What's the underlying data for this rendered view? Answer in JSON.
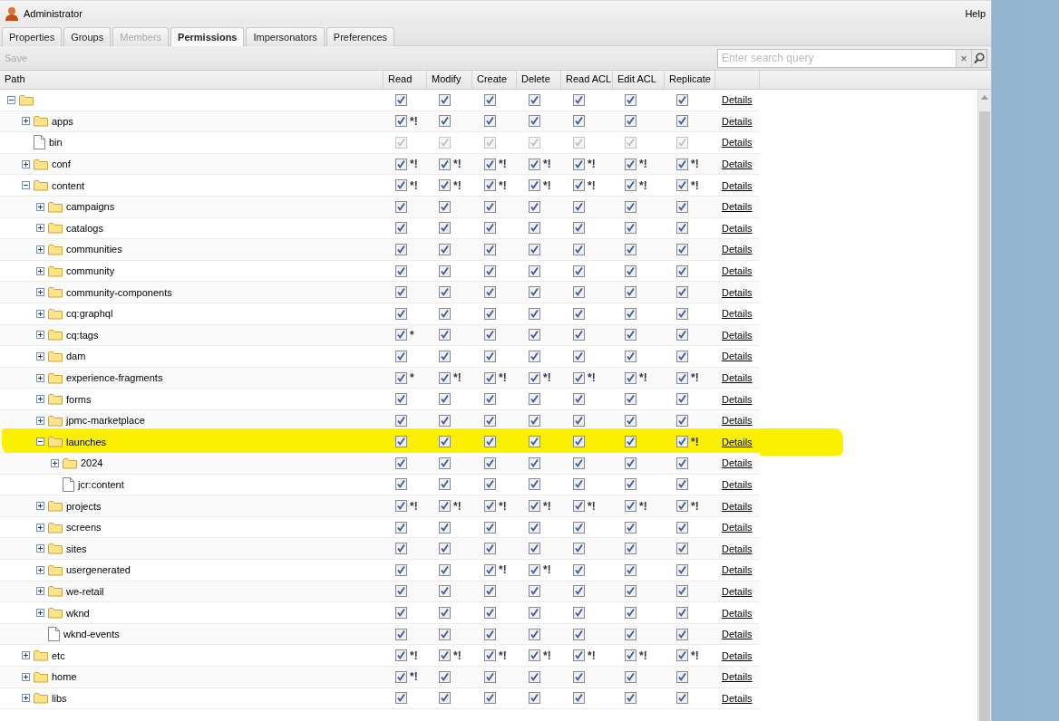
{
  "window": {
    "title": "Administrator",
    "help": "Help"
  },
  "tabs": [
    {
      "label": "Properties",
      "selected": false,
      "disabled": false
    },
    {
      "label": "Groups",
      "selected": false,
      "disabled": false
    },
    {
      "label": "Members",
      "selected": false,
      "disabled": true
    },
    {
      "label": "Permissions",
      "selected": true,
      "disabled": false
    },
    {
      "label": "Impersonators",
      "selected": false,
      "disabled": false
    },
    {
      "label": "Preferences",
      "selected": false,
      "disabled": false
    }
  ],
  "toolbar": {
    "save": {
      "label": "Save",
      "disabled": true
    },
    "search": {
      "placeholder": "Enter search query",
      "clear": "×"
    }
  },
  "table": {
    "columns": [
      "Path",
      "Read",
      "Modify",
      "Create",
      "Delete",
      "Read ACL",
      "Edit ACL",
      "Replicate"
    ],
    "tree": [
      {
        "kind": "folder",
        "expanded": true,
        "disabled": false,
        "highlighted": false,
        "details": "Details",
        "perms": [
          {
            "checked": true
          },
          {
            "checked": true
          },
          {
            "checked": true
          },
          {
            "checked": true
          },
          {
            "checked": true
          },
          {
            "checked": true
          },
          {
            "checked": true
          }
        ],
        "children": [
          {
            "name": "apps",
            "kind": "folder",
            "expanded": false,
            "disabled": false,
            "highlighted": false,
            "details": "Details",
            "perms": [
              {
                "checked": true,
                "note": "*!"
              },
              {
                "checked": true
              },
              {
                "checked": true
              },
              {
                "checked": true
              },
              {
                "checked": true
              },
              {
                "checked": true
              },
              {
                "checked": true
              }
            ]
          },
          {
            "name": "bin",
            "kind": "file",
            "disabled": true,
            "highlighted": false,
            "details": "Details",
            "perms": [
              {
                "checked": true
              },
              {
                "checked": true
              },
              {
                "checked": true
              },
              {
                "checked": true
              },
              {
                "checked": true
              },
              {
                "checked": true
              },
              {
                "checked": true
              }
            ]
          },
          {
            "name": "conf",
            "kind": "folder",
            "expanded": false,
            "disabled": false,
            "highlighted": false,
            "details": "Details",
            "perms": [
              {
                "checked": true,
                "note": "*!"
              },
              {
                "checked": true,
                "note": "*!"
              },
              {
                "checked": true,
                "note": "*!"
              },
              {
                "checked": true,
                "note": "*!"
              },
              {
                "checked": true,
                "note": "*!"
              },
              {
                "checked": true,
                "note": "*!"
              },
              {
                "checked": true,
                "note": "*!"
              }
            ]
          },
          {
            "name": "content",
            "kind": "folder",
            "expanded": true,
            "disabled": false,
            "highlighted": false,
            "details": "Details",
            "perms": [
              {
                "checked": true,
                "note": "*!"
              },
              {
                "checked": true,
                "note": "*!"
              },
              {
                "checked": true,
                "note": "*!"
              },
              {
                "checked": true,
                "note": "*!"
              },
              {
                "checked": true,
                "note": "*!"
              },
              {
                "checked": true,
                "note": "*!"
              },
              {
                "checked": true,
                "note": "*!"
              }
            ],
            "children": [
              {
                "name": "campaigns",
                "kind": "folder",
                "expanded": false,
                "disabled": false,
                "highlighted": false,
                "details": "Details",
                "perms": [
                  {
                    "checked": true
                  },
                  {
                    "checked": true
                  },
                  {
                    "checked": true
                  },
                  {
                    "checked": true
                  },
                  {
                    "checked": true
                  },
                  {
                    "checked": true
                  },
                  {
                    "checked": true
                  }
                ]
              },
              {
                "name": "catalogs",
                "kind": "folder",
                "expanded": false,
                "disabled": false,
                "highlighted": false,
                "details": "Details",
                "perms": [
                  {
                    "checked": true
                  },
                  {
                    "checked": true
                  },
                  {
                    "checked": true
                  },
                  {
                    "checked": true
                  },
                  {
                    "checked": true
                  },
                  {
                    "checked": true
                  },
                  {
                    "checked": true
                  }
                ]
              },
              {
                "name": "communities",
                "kind": "folder",
                "expanded": false,
                "disabled": false,
                "highlighted": false,
                "details": "Details",
                "perms": [
                  {
                    "checked": true
                  },
                  {
                    "checked": true
                  },
                  {
                    "checked": true
                  },
                  {
                    "checked": true
                  },
                  {
                    "checked": true
                  },
                  {
                    "checked": true
                  },
                  {
                    "checked": true
                  }
                ]
              },
              {
                "name": "community",
                "kind": "folder",
                "expanded": false,
                "disabled": false,
                "highlighted": false,
                "details": "Details",
                "perms": [
                  {
                    "checked": true
                  },
                  {
                    "checked": true
                  },
                  {
                    "checked": true
                  },
                  {
                    "checked": true
                  },
                  {
                    "checked": true
                  },
                  {
                    "checked": true
                  },
                  {
                    "checked": true
                  }
                ]
              },
              {
                "name": "community-components",
                "kind": "folder",
                "expanded": false,
                "disabled": false,
                "highlighted": false,
                "details": "Details",
                "perms": [
                  {
                    "checked": true
                  },
                  {
                    "checked": true
                  },
                  {
                    "checked": true
                  },
                  {
                    "checked": true
                  },
                  {
                    "checked": true
                  },
                  {
                    "checked": true
                  },
                  {
                    "checked": true
                  }
                ]
              },
              {
                "name": "cq:graphql",
                "kind": "folder",
                "expanded": false,
                "disabled": false,
                "highlighted": false,
                "details": "Details",
                "perms": [
                  {
                    "checked": true
                  },
                  {
                    "checked": true
                  },
                  {
                    "checked": true
                  },
                  {
                    "checked": true
                  },
                  {
                    "checked": true
                  },
                  {
                    "checked": true
                  },
                  {
                    "checked": true
                  }
                ]
              },
              {
                "name": "cq:tags",
                "kind": "folder",
                "expanded": false,
                "disabled": false,
                "highlighted": false,
                "details": "Details",
                "perms": [
                  {
                    "checked": true,
                    "note": "*"
                  },
                  {
                    "checked": true
                  },
                  {
                    "checked": true
                  },
                  {
                    "checked": true
                  },
                  {
                    "checked": true
                  },
                  {
                    "checked": true
                  },
                  {
                    "checked": true
                  }
                ]
              },
              {
                "name": "dam",
                "kind": "folder",
                "expanded": false,
                "disabled": false,
                "highlighted": false,
                "details": "Details",
                "perms": [
                  {
                    "checked": true
                  },
                  {
                    "checked": true
                  },
                  {
                    "checked": true
                  },
                  {
                    "checked": true
                  },
                  {
                    "checked": true
                  },
                  {
                    "checked": true
                  },
                  {
                    "checked": true
                  }
                ]
              },
              {
                "name": "experience-fragments",
                "kind": "folder",
                "expanded": false,
                "disabled": false,
                "highlighted": false,
                "details": "Details",
                "perms": [
                  {
                    "checked": true,
                    "note": "*"
                  },
                  {
                    "checked": true,
                    "note": "*!"
                  },
                  {
                    "checked": true,
                    "note": "*!"
                  },
                  {
                    "checked": true,
                    "note": "*!"
                  },
                  {
                    "checked": true,
                    "note": "*!"
                  },
                  {
                    "checked": true,
                    "note": "*!"
                  },
                  {
                    "checked": true,
                    "note": "*!"
                  }
                ]
              },
              {
                "name": "forms",
                "kind": "folder",
                "expanded": false,
                "disabled": false,
                "highlighted": false,
                "details": "Details",
                "perms": [
                  {
                    "checked": true
                  },
                  {
                    "checked": true
                  },
                  {
                    "checked": true
                  },
                  {
                    "checked": true
                  },
                  {
                    "checked": true
                  },
                  {
                    "checked": true
                  },
                  {
                    "checked": true
                  }
                ]
              },
              {
                "name": "jpmc-marketplace",
                "kind": "folder",
                "expanded": false,
                "disabled": false,
                "highlighted": false,
                "details": "Details",
                "perms": [
                  {
                    "checked": true
                  },
                  {
                    "checked": true
                  },
                  {
                    "checked": true
                  },
                  {
                    "checked": true
                  },
                  {
                    "checked": true
                  },
                  {
                    "checked": true
                  },
                  {
                    "checked": true
                  }
                ]
              },
              {
                "name": "launches",
                "kind": "folder",
                "expanded": true,
                "disabled": false,
                "highlighted": true,
                "details": "Details",
                "perms": [
                  {
                    "checked": true
                  },
                  {
                    "checked": true
                  },
                  {
                    "checked": true
                  },
                  {
                    "checked": true
                  },
                  {
                    "checked": true
                  },
                  {
                    "checked": true
                  },
                  {
                    "checked": true,
                    "note": "*!"
                  }
                ],
                "children": [
                  {
                    "name": "2024",
                    "kind": "folder",
                    "expanded": false,
                    "disabled": false,
                    "highlighted": false,
                    "details": "Details",
                    "perms": [
                      {
                        "checked": true
                      },
                      {
                        "checked": true
                      },
                      {
                        "checked": true
                      },
                      {
                        "checked": true
                      },
                      {
                        "checked": true
                      },
                      {
                        "checked": true
                      },
                      {
                        "checked": true
                      }
                    ]
                  },
                  {
                    "name": "jcr:content",
                    "kind": "file",
                    "disabled": false,
                    "highlighted": false,
                    "details": "Details",
                    "perms": [
                      {
                        "checked": true
                      },
                      {
                        "checked": true
                      },
                      {
                        "checked": true
                      },
                      {
                        "checked": true
                      },
                      {
                        "checked": true
                      },
                      {
                        "checked": true
                      },
                      {
                        "checked": true
                      }
                    ]
                  }
                ]
              },
              {
                "name": "projects",
                "kind": "folder",
                "expanded": false,
                "disabled": false,
                "highlighted": false,
                "details": "Details",
                "perms": [
                  {
                    "checked": true,
                    "note": "*!"
                  },
                  {
                    "checked": true,
                    "note": "*!"
                  },
                  {
                    "checked": true,
                    "note": "*!"
                  },
                  {
                    "checked": true,
                    "note": "*!"
                  },
                  {
                    "checked": true,
                    "note": "*!"
                  },
                  {
                    "checked": true,
                    "note": "*!"
                  },
                  {
                    "checked": true,
                    "note": "*!"
                  }
                ]
              },
              {
                "name": "screens",
                "kind": "folder",
                "expanded": false,
                "disabled": false,
                "highlighted": false,
                "details": "Details",
                "perms": [
                  {
                    "checked": true
                  },
                  {
                    "checked": true
                  },
                  {
                    "checked": true
                  },
                  {
                    "checked": true
                  },
                  {
                    "checked": true
                  },
                  {
                    "checked": true
                  },
                  {
                    "checked": true
                  }
                ]
              },
              {
                "name": "sites",
                "kind": "folder",
                "expanded": false,
                "disabled": false,
                "highlighted": false,
                "details": "Details",
                "perms": [
                  {
                    "checked": true
                  },
                  {
                    "checked": true
                  },
                  {
                    "checked": true
                  },
                  {
                    "checked": true
                  },
                  {
                    "checked": true
                  },
                  {
                    "checked": true
                  },
                  {
                    "checked": true
                  }
                ]
              },
              {
                "name": "usergenerated",
                "kind": "folder",
                "expanded": false,
                "disabled": false,
                "highlighted": false,
                "details": "Details",
                "perms": [
                  {
                    "checked": true
                  },
                  {
                    "checked": true
                  },
                  {
                    "checked": true,
                    "note": "*!"
                  },
                  {
                    "checked": true,
                    "note": "*!"
                  },
                  {
                    "checked": true
                  },
                  {
                    "checked": true
                  },
                  {
                    "checked": true
                  }
                ]
              },
              {
                "name": "we-retail",
                "kind": "folder",
                "expanded": false,
                "disabled": false,
                "highlighted": false,
                "details": "Details",
                "perms": [
                  {
                    "checked": true
                  },
                  {
                    "checked": true
                  },
                  {
                    "checked": true
                  },
                  {
                    "checked": true
                  },
                  {
                    "checked": true
                  },
                  {
                    "checked": true
                  },
                  {
                    "checked": true
                  }
                ]
              },
              {
                "name": "wknd",
                "kind": "folder",
                "expanded": false,
                "disabled": false,
                "highlighted": false,
                "details": "Details",
                "perms": [
                  {
                    "checked": true
                  },
                  {
                    "checked": true
                  },
                  {
                    "checked": true
                  },
                  {
                    "checked": true
                  },
                  {
                    "checked": true
                  },
                  {
                    "checked": true
                  },
                  {
                    "checked": true
                  }
                ]
              },
              {
                "name": "wknd-events",
                "kind": "file",
                "disabled": false,
                "highlighted": false,
                "details": "Details",
                "perms": [
                  {
                    "checked": true
                  },
                  {
                    "checked": true
                  },
                  {
                    "checked": true
                  },
                  {
                    "checked": true
                  },
                  {
                    "checked": true
                  },
                  {
                    "checked": true
                  },
                  {
                    "checked": true
                  }
                ]
              }
            ]
          },
          {
            "name": "etc",
            "kind": "folder",
            "expanded": false,
            "disabled": false,
            "highlighted": false,
            "details": "Details",
            "perms": [
              {
                "checked": true,
                "note": "*!"
              },
              {
                "checked": true,
                "note": "*!"
              },
              {
                "checked": true,
                "note": "*!"
              },
              {
                "checked": true,
                "note": "*!"
              },
              {
                "checked": true,
                "note": "*!"
              },
              {
                "checked": true,
                "note": "*!"
              },
              {
                "checked": true,
                "note": "*!"
              }
            ]
          },
          {
            "name": "home",
            "kind": "folder",
            "expanded": false,
            "disabled": false,
            "highlighted": false,
            "details": "Details",
            "perms": [
              {
                "checked": true,
                "note": "*!"
              },
              {
                "checked": true
              },
              {
                "checked": true
              },
              {
                "checked": true
              },
              {
                "checked": true
              },
              {
                "checked": true
              },
              {
                "checked": true
              }
            ]
          },
          {
            "name": "libs",
            "kind": "folder",
            "expanded": false,
            "disabled": false,
            "highlighted": false,
            "details": "Details",
            "perms": [
              {
                "checked": true
              },
              {
                "checked": true
              },
              {
                "checked": true
              },
              {
                "checked": true
              },
              {
                "checked": true
              },
              {
                "checked": true
              },
              {
                "checked": true
              }
            ]
          }
        ]
      }
    ]
  }
}
